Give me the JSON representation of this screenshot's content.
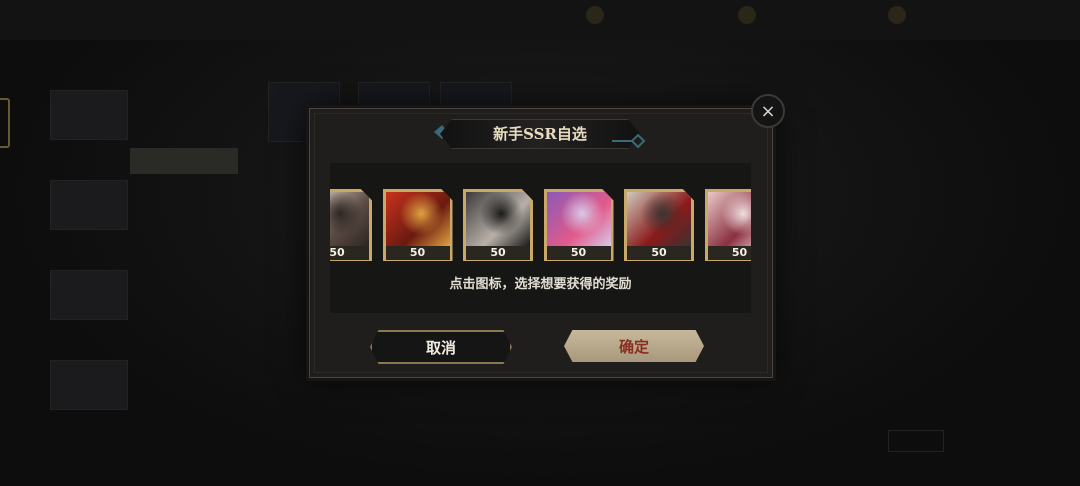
{
  "modal": {
    "title": "新手SSR自选",
    "hint": "点击图标，选择想要获得的奖励",
    "cancel_label": "取消",
    "confirm_label": "确定",
    "close_icon": "×"
  },
  "heroes": [
    {
      "count": "50",
      "palette": [
        "#e7d8c8",
        "#5a4a44",
        "#2d2622"
      ]
    },
    {
      "count": "50",
      "palette": [
        "#c8321e",
        "#6b1a10",
        "#e0a040"
      ]
    },
    {
      "count": "50",
      "palette": [
        "#3c3c3c",
        "#b8b0a8",
        "#1a1a1a"
      ]
    },
    {
      "count": "50",
      "palette": [
        "#8a5ab8",
        "#e25a8a",
        "#d8c8e8"
      ]
    },
    {
      "count": "50",
      "palette": [
        "#cfc8bc",
        "#8a1a1a",
        "#3a3330"
      ]
    },
    {
      "count": "50",
      "palette": [
        "#e8c8c8",
        "#8a3040",
        "#f0e0e0"
      ]
    }
  ],
  "colors": {
    "gold": "#c9a86a",
    "confirm_text": "#8a2e22",
    "title_text": "#e8dcc0"
  }
}
